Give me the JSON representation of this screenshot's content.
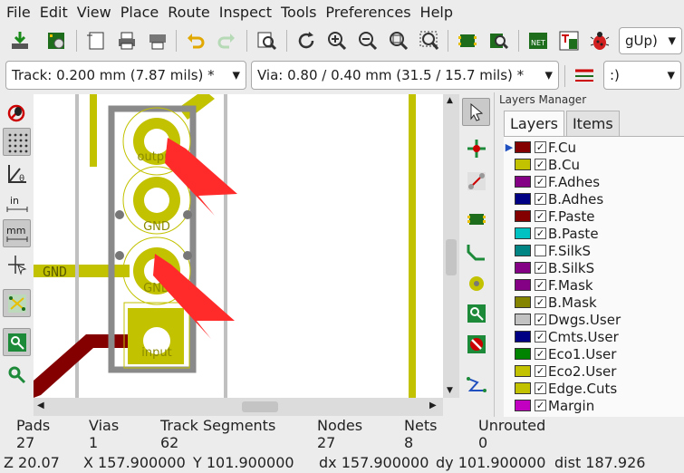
{
  "menu": [
    "File",
    "Edit",
    "View",
    "Place",
    "Route",
    "Inspect",
    "Tools",
    "Preferences",
    "Help"
  ],
  "toolbar": {
    "icons": [
      "save-board-icon",
      "board-setup-icon",
      "page-settings-icon",
      "print-icon",
      "plot-icon",
      "undo-icon",
      "redo-icon",
      "find-icon",
      "refresh-icon",
      "zoom-in-icon",
      "zoom-out-icon",
      "zoom-fit-icon",
      "zoom-selection-icon",
      "footprint-editor-icon",
      "footprint-browser-icon",
      "netlist-icon",
      "update-pcb-icon",
      "drc-icon"
    ],
    "layer_combo": "gUp)"
  },
  "aux": {
    "track": "Track: 0.200 mm (7.87 mils) *",
    "via": "Via: 0.80 / 0.40 mm (31.5 / 15.7 mils) *",
    "grid": ":)"
  },
  "left_tools": [
    "drc-toggle-icon",
    "grid-toggle-icon",
    "polar-coords-icon",
    "inch-units-icon",
    "mm-units-icon",
    "cursor-shape-icon",
    "ratsnest-icon",
    "filled-zones-icon",
    "outline-tracks-icon"
  ],
  "right_tools": [
    "select-arrow-icon",
    "highlight-net-icon",
    "local-ratsnest-icon",
    "add-footprint-icon",
    "route-track-icon",
    "add-via-icon",
    "add-zone-icon",
    "keepout-icon",
    "add-line-icon"
  ],
  "canvas": {
    "net_label": "GND",
    "pad_labels": [
      "output",
      "GND",
      "GND",
      "input"
    ]
  },
  "layers_manager": {
    "title": "Layers Manager",
    "tabs": [
      "Layers",
      "Items"
    ],
    "layers": [
      {
        "name": "F.Cu",
        "color": "#840000",
        "checked": true,
        "active": true
      },
      {
        "name": "B.Cu",
        "color": "#c2c200",
        "checked": true
      },
      {
        "name": "F.Adhes",
        "color": "#840084",
        "checked": true
      },
      {
        "name": "B.Adhes",
        "color": "#000084",
        "checked": true
      },
      {
        "name": "F.Paste",
        "color": "#840000",
        "checked": true
      },
      {
        "name": "B.Paste",
        "color": "#00c2c2",
        "checked": true
      },
      {
        "name": "F.SilkS",
        "color": "#008484",
        "checked": false
      },
      {
        "name": "B.SilkS",
        "color": "#840084",
        "checked": true
      },
      {
        "name": "F.Mask",
        "color": "#840084",
        "checked": true
      },
      {
        "name": "B.Mask",
        "color": "#848400",
        "checked": true
      },
      {
        "name": "Dwgs.User",
        "color": "#c2c2c2",
        "checked": true
      },
      {
        "name": "Cmts.User",
        "color": "#000084",
        "checked": true
      },
      {
        "name": "Eco1.User",
        "color": "#008400",
        "checked": true
      },
      {
        "name": "Eco2.User",
        "color": "#c2c200",
        "checked": true
      },
      {
        "name": "Edge.Cuts",
        "color": "#c2c200",
        "checked": true
      },
      {
        "name": "Margin",
        "color": "#c200c2",
        "checked": true
      }
    ]
  },
  "stats": [
    {
      "label": "Pads",
      "value": "27"
    },
    {
      "label": "Vias",
      "value": "1"
    },
    {
      "label": "Track Segments",
      "value": "62"
    },
    {
      "label": "Nodes",
      "value": "27"
    },
    {
      "label": "Nets",
      "value": "8"
    },
    {
      "label": "Unrouted",
      "value": "0"
    }
  ],
  "coords": {
    "zoom": "Z 20.07",
    "x": "X 157.900000",
    "y": "Y 101.900000",
    "dx": "dx 157.900000",
    "dy": "dy 101.900000",
    "dist": "dist 187.926"
  }
}
